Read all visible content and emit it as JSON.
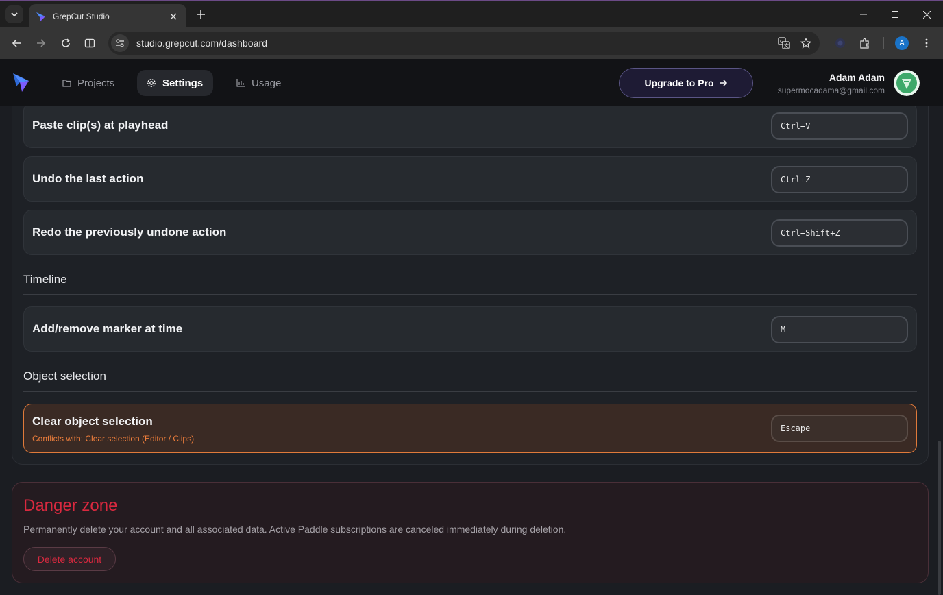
{
  "browser": {
    "tab_title": "GrepCut Studio",
    "url": "studio.grepcut.com/dashboard",
    "profile_initial": "A"
  },
  "header": {
    "nav": [
      {
        "label": "Projects",
        "icon": "folder-icon"
      },
      {
        "label": "Settings",
        "icon": "gear-icon"
      },
      {
        "label": "Usage",
        "icon": "bar-chart-icon"
      }
    ],
    "upgrade_label": "Upgrade to Pro",
    "user_name": "Adam Adam",
    "user_email": "supermocadama@gmail.com"
  },
  "shortcuts": {
    "rows_top": [
      {
        "label": "Paste clip(s) at playhead",
        "key": "Ctrl+V"
      },
      {
        "label": "Undo the last action",
        "key": "Ctrl+Z"
      },
      {
        "label": "Redo the previously undone action",
        "key": "Ctrl+Shift+Z"
      }
    ],
    "timeline": {
      "title": "Timeline",
      "rows": [
        {
          "label": "Add/remove marker at time",
          "key": "M"
        }
      ]
    },
    "object_selection": {
      "title": "Object selection",
      "rows": [
        {
          "label": "Clear object selection",
          "key": "Escape",
          "conflict": "Conflicts with: Clear selection (Editor / Clips)"
        }
      ]
    }
  },
  "danger_zone": {
    "title": "Danger zone",
    "description": "Permanently delete your account and all associated data. Active Paddle subscriptions are canceled immediately during deletion.",
    "delete_label": "Delete account"
  },
  "colors": {
    "accent": "#5a5585",
    "danger": "#d9293f",
    "conflict": "#f07f3c"
  }
}
